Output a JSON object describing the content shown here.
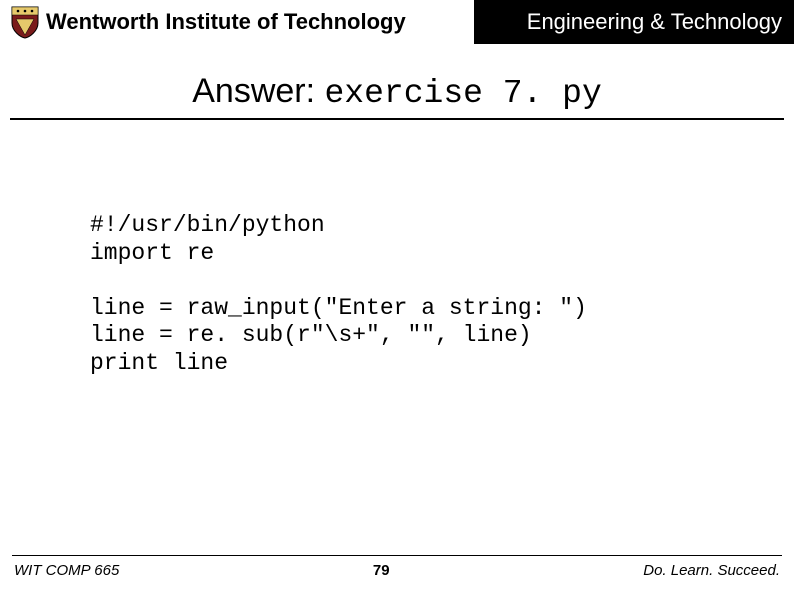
{
  "header": {
    "institute": "Wentworth Institute of Technology",
    "department": "Engineering & Technology"
  },
  "title": {
    "prefix": "Answer: ",
    "filename": "exercise 7. py"
  },
  "code": "#!/usr/bin/python\nimport re\n\nline = raw_input(\"Enter a string: \")\nline = re. sub(r\"\\s+\", \"\", line)\nprint line",
  "footer": {
    "left": "WIT COMP 665",
    "page": "79",
    "right": "Do. Learn. Succeed."
  }
}
